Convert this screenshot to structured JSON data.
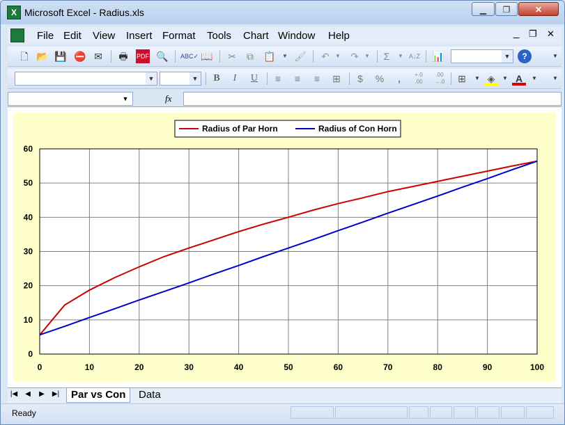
{
  "window": {
    "title": "Microsoft Excel - Radius.xls",
    "minimize": "▁",
    "restore": "❐",
    "close": "✕"
  },
  "menubar": {
    "items": [
      "File",
      "Edit",
      "View",
      "Insert",
      "Format",
      "Tools",
      "Chart",
      "Window",
      "Help"
    ],
    "doc_minimize": "_",
    "doc_restore": "❐",
    "doc_close": "✕"
  },
  "toolbar": {
    "icons": [
      "new-icon",
      "open-icon",
      "save-icon",
      "permission-icon",
      "email-icon",
      "print-icon",
      "pdf-icon",
      "print-preview-icon",
      "spelling-icon",
      "research-icon",
      "cut-icon",
      "copy-icon",
      "paste-icon",
      "format-painter-icon",
      "undo-icon",
      "redo-icon",
      "autosum-icon",
      "sort-icon",
      "chart-wizard-icon",
      "help-icon"
    ],
    "zoom_value": ""
  },
  "format_toolbar": {
    "font_value": "",
    "size_value": "",
    "bold": "B",
    "italic": "I",
    "underline": "U",
    "currency": "$",
    "percent": "%",
    "comma": ",",
    "increase_decimal": "+.0 .00",
    "decrease_decimal": ".00 →.0",
    "font_color_letter": "A"
  },
  "formula_bar": {
    "name_box": "",
    "fx": "fx",
    "formula": ""
  },
  "chart_data": {
    "type": "line",
    "xlim": [
      0,
      100
    ],
    "ylim": [
      0,
      60
    ],
    "xticks": [
      0,
      10,
      20,
      30,
      40,
      50,
      60,
      70,
      80,
      90,
      100
    ],
    "yticks": [
      0,
      10,
      20,
      30,
      40,
      50,
      60
    ],
    "grid": true,
    "legend_position": "top-center",
    "x": [
      0,
      5,
      10,
      15,
      20,
      25,
      30,
      35,
      40,
      45,
      50,
      55,
      60,
      65,
      70,
      75,
      80,
      85,
      90,
      95,
      100
    ],
    "series": [
      {
        "name": "Radius of Par Horn",
        "color": "#cc0000",
        "values": [
          5.6,
          14.3,
          18.7,
          22.3,
          25.5,
          28.5,
          31.0,
          33.4,
          35.8,
          38.0,
          40.0,
          42.1,
          44.0,
          45.7,
          47.5,
          49.0,
          50.5,
          52.0,
          53.5,
          55.0,
          56.4
        ]
      },
      {
        "name": "Radius of Con Horn",
        "color": "#0000cc",
        "values": [
          5.6,
          8.1,
          10.7,
          13.2,
          15.8,
          18.3,
          20.8,
          23.4,
          25.9,
          28.5,
          31.0,
          33.5,
          36.1,
          38.6,
          41.2,
          43.7,
          46.2,
          48.8,
          51.3,
          53.9,
          56.4
        ]
      }
    ]
  },
  "sheet_tabs": {
    "nav": [
      "|◀",
      "◀",
      "▶",
      "▶|"
    ],
    "tabs": [
      "Par vs Con",
      "Data"
    ],
    "active": "Par vs Con"
  },
  "status": {
    "text": "Ready"
  }
}
